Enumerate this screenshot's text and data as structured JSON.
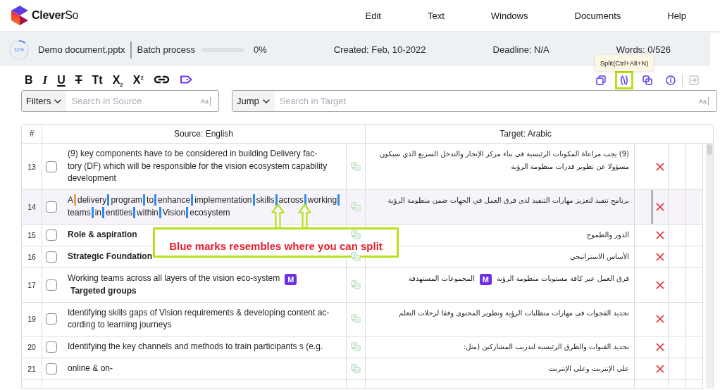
{
  "app_bar": {
    "logo": "**Clever**So",
    "menu": [
      "Edit",
      "Text",
      "Windows",
      "Documents",
      "Help"
    ]
  },
  "document_bar": {
    "progress": {
      "level": 0.11,
      "label": "11%"
    },
    "file_name": "Demo document.pptx",
    "batch": {
      "label": "Batch process",
      "level": 0,
      "reading": "0%"
    },
    "created": "Created: Feb, 10-2022",
    "deadline": "Deadline: N/A",
    "words": "Words: 0/526"
  },
  "format_toolbar": [
    {
      "kind": "bold",
      "label": "B"
    },
    {
      "kind": "italic",
      "label": "I"
    },
    {
      "kind": "underline",
      "label": "U"
    },
    {
      "kind": "strike",
      "label": "T"
    },
    {
      "kind": "case",
      "label": "Tt"
    },
    {
      "kind": "subscript",
      "label": "X$_{2}$"
    },
    {
      "kind": "superscript",
      "label": "X$^{2}$"
    },
    {
      "kind": "link"
    },
    {
      "kind": "tag"
    }
  ],
  "segment_tools": [
    {
      "kind": "copy",
      "disabled": false,
      "highlighted": false
    },
    {
      "kind": "split",
      "disabled": false,
      "highlighted": true,
      "tooltip": "Split(Ctrl+Alt+N)"
    },
    {
      "kind": "merge",
      "disabled": false,
      "highlighted": false
    },
    {
      "kind": "info",
      "disabled": false,
      "highlighted": false
    },
    {
      "kind": "exit",
      "disabled": true,
      "highlighted": false
    }
  ],
  "source_search": {
    "dropdown": "Filters",
    "placeholder": "Search in Source",
    "match_case": "Aa"
  },
  "target_search": {
    "dropdown": "Jump",
    "placeholder": "Search in Target",
    "match_case": "Aa"
  },
  "table": {
    "columns": [
      "#",
      "Source: English",
      "Target: Arabic"
    ],
    "rows": [
      {
        "number": "13",
        "checked": false,
        "selected": false,
        "source": [
          {
            "kind": "text",
            "text": "(9) key components have to be considered in building Delivery fac-\ntory (DF) which will be responsible for the vision ecosystem capability\ndevelopment"
          }
        ],
        "target": [
          {
            "kind": "text",
            "text": "(9) يجب مراعاة المكونات الرئيسية في بناء مركز الإنجاز والتدخل السريع الذي سيكون مسؤولا عن تطوير قدرات منظومة الرؤية"
          }
        ]
      },
      {
        "number": "14",
        "checked": false,
        "selected": true,
        "source": [
          {
            "kind": "word",
            "text": "A",
            "color": "#f5a03a"
          },
          {
            "kind": "word",
            "text": "delivery",
            "color": "#2d8cf0"
          },
          {
            "kind": "word",
            "text": "program",
            "color": "#2d8cf0"
          },
          {
            "kind": "word",
            "text": "to",
            "color": "#2d8cf0"
          },
          {
            "kind": "word",
            "text": "enhance",
            "color": "#2d8cf0"
          },
          {
            "kind": "word",
            "text": "implementation",
            "color": "#2d8cf0"
          },
          {
            "kind": "word",
            "text": "skills",
            "color": "#2d8cf0"
          },
          {
            "kind": "word",
            "text": "across",
            "color": "#2d8cf0"
          },
          {
            "kind": "word",
            "text": "working",
            "color": "#2d8cf0"
          },
          {
            "kind": "word",
            "text": "teams",
            "color": "#2d8cf0"
          },
          {
            "kind": "word",
            "text": "in",
            "color": "#2d8cf0"
          },
          {
            "kind": "word",
            "text": "entities",
            "color": "#2d8cf0"
          },
          {
            "kind": "word",
            "text": "within",
            "color": "#2d8cf0"
          },
          {
            "kind": "word",
            "text": "Vision",
            "color": "#2d8cf0"
          },
          {
            "kind": "word",
            "text": "ecosystem"
          }
        ],
        "target": [
          {
            "kind": "text",
            "text": "برنامج تنفيذ لتعزيز مهارات التنفيذ لدى فرق العمل في الجهات ضمن منظومة الرؤية"
          }
        ]
      },
      {
        "number": "15",
        "checked": false,
        "selected": false,
        "source": [
          {
            "kind": "bold",
            "text": "Role & aspiration"
          }
        ],
        "target": [
          {
            "kind": "text",
            "text": "الدور والطموح"
          }
        ]
      },
      {
        "number": "16",
        "checked": false,
        "selected": false,
        "source": [
          {
            "kind": "bold",
            "text": "Strategic Foundation"
          }
        ],
        "target": [
          {
            "kind": "text",
            "text": "الأساس الاستراتيجي"
          }
        ]
      },
      {
        "number": "17",
        "checked": false,
        "selected": false,
        "source": [
          {
            "kind": "text",
            "text": "Working teams across all layers of the vision eco-system"
          },
          {
            "kind": "tag",
            "text": "M"
          },
          {
            "kind": "bold",
            "text": "Targeted groups"
          }
        ],
        "target": [
          {
            "kind": "text",
            "text": "فرق العمل عبر كافة مستويات منظومة الرؤية"
          },
          {
            "kind": "tag",
            "text": "M"
          },
          {
            "kind": "text",
            "text": "المجموعات المستهدفة"
          }
        ]
      },
      {
        "number": "19",
        "checked": false,
        "selected": false,
        "source": [
          {
            "kind": "text",
            "text": "Identifying skills gaps of Vision requirements & developing content ac-\ncording to learning journeys"
          }
        ],
        "target": [
          {
            "kind": "text",
            "text": "تحديد الفجوات في مهارات متطلبات الرؤية وتطوير المحتوى وفقا لرحلات التعلم"
          }
        ]
      },
      {
        "number": "20",
        "checked": false,
        "selected": false,
        "source": [
          {
            "kind": "text",
            "text": "Identifying the key channels and methods to train participants s (e.g."
          }
        ],
        "target": [
          {
            "kind": "text",
            "text": "تحديد القنوات والطرق الرئيسية لتدريب المشاركين (مثل:"
          }
        ]
      },
      {
        "number": "21",
        "checked": false,
        "selected": false,
        "source": [
          {
            "kind": "text",
            "text": "online & on-"
          }
        ],
        "target": [
          {
            "kind": "text",
            "text": "على الإنترنت وعلى الإنترنت"
          }
        ]
      }
    ]
  },
  "annotation": {
    "text": "Blue marks resembles where you can split"
  }
}
